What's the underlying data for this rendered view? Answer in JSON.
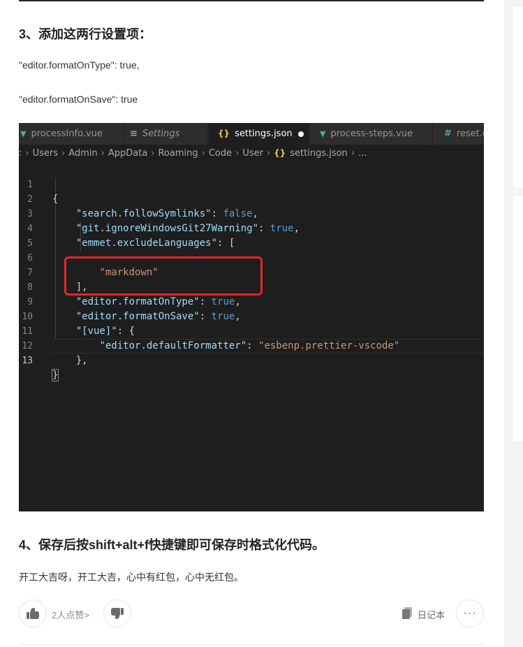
{
  "article": {
    "step3_heading": "3、添加这两行设置项：",
    "setting_line_1": "\"editor.formatOnType\": true,",
    "setting_line_2": "\"editor.formatOnSave\": true",
    "step4_heading": "4、保存后按shift+alt+f快捷键即可保存时格式化代码。",
    "closing_text": "开工大吉呀，开工大吉，心中有红包，心中无红包。"
  },
  "editor_screenshot": {
    "tabs": [
      {
        "label": "processInfo.vue",
        "icon": "vue-icon"
      },
      {
        "label": "Settings",
        "icon": "settings-list-icon"
      },
      {
        "label": "settings.json",
        "icon": "json-braces-icon",
        "active": true,
        "unsaved": true
      },
      {
        "label": "process-steps.vue",
        "icon": "vue-icon"
      },
      {
        "label": "reset.c",
        "icon": "hash-icon"
      }
    ],
    "breadcrumb": {
      "lead": ":",
      "parts": [
        "Users",
        "Admin",
        "AppData",
        "Roaming",
        "Code",
        "User"
      ],
      "file": "settings.json",
      "tail": "..."
    },
    "lines": [
      {
        "n": "1"
      },
      {
        "n": "2"
      },
      {
        "n": "3"
      },
      {
        "n": "4"
      },
      {
        "n": "5"
      },
      {
        "n": "6"
      },
      {
        "n": "7"
      },
      {
        "n": "8"
      },
      {
        "n": "9"
      },
      {
        "n": "10"
      },
      {
        "n": "11"
      },
      {
        "n": "12"
      },
      {
        "n": "13"
      }
    ],
    "tokens": {
      "l1_open": "{",
      "l2_key": "\"search.followSymlinks\"",
      "l2_val": "false",
      "l3_key": "\"git.ignoreWindowsGit27Warning\"",
      "l3_val": "true",
      "l4_key": "\"emmet.excludeLanguages\"",
      "l4_open": "[",
      "l6_val": "\"markdown\"",
      "l7_close": "],",
      "l8_key": "\"editor.formatOnType\"",
      "l8_val": "true",
      "l9_key": "\"editor.formatOnSave\"",
      "l9_val": "true",
      "l10_key": "\"[vue]\"",
      "l10_open": "{",
      "l11_key": "\"editor.defaultFormatter\"",
      "l11_val": "\"esbenp.prettier-vscode\"",
      "l12_close": "},",
      "l13_close": "}"
    },
    "colors": {
      "background": "#1e1e1e",
      "key": "#9cdcfe",
      "string": "#ce9178",
      "boolean": "#569cd6",
      "highlight_box": "#e5262b"
    }
  },
  "actions": {
    "likes_label": "2人点赞",
    "likes_chevron": ">",
    "notes_label": "日记本",
    "more_label": "···"
  }
}
